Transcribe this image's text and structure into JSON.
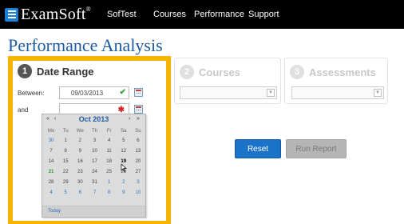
{
  "app": {
    "logo": "ExamSoft",
    "logo_mark": "®"
  },
  "nav": {
    "items": [
      {
        "label": "SofTest"
      },
      {
        "label": "Courses"
      },
      {
        "label": "Performance"
      },
      {
        "label": "Support"
      }
    ]
  },
  "page": {
    "title": "Performance Analysis"
  },
  "steps": [
    {
      "number": "1",
      "label": "Date Range"
    },
    {
      "number": "2",
      "label": "Courses"
    },
    {
      "number": "3",
      "label": "Assessments"
    }
  ],
  "date_range": {
    "between_label": "Between:",
    "and_label": "and",
    "start_value": "09/03/2013",
    "end_value": "",
    "valid_icon": "checkmark-icon",
    "required_icon": "asterisk-icon"
  },
  "calendar": {
    "month_label": "Oct 2013",
    "prev_year": "«",
    "prev_month": "‹",
    "next_month": "›",
    "next_year": "»",
    "weekdays": [
      "Mo",
      "Tu",
      "We",
      "Th",
      "Fr",
      "Sa",
      "Su"
    ],
    "weeks": [
      [
        "30",
        "1",
        "2",
        "3",
        "4",
        "5",
        "6"
      ],
      [
        "7",
        "8",
        "9",
        "10",
        "11",
        "12",
        "13"
      ],
      [
        "14",
        "15",
        "16",
        "17",
        "18",
        "19",
        "20"
      ],
      [
        "21",
        "22",
        "23",
        "24",
        "25",
        "26",
        "27"
      ],
      [
        "28",
        "29",
        "30",
        "31",
        "1",
        "2",
        "3"
      ],
      [
        "4",
        "5",
        "6",
        "7",
        "8",
        "9",
        "10"
      ]
    ],
    "today_label": "Today"
  },
  "actions": {
    "reset_label": "Reset",
    "run_label": "Run Report"
  },
  "colors": {
    "brand_blue": "#1d5a9e",
    "highlight": "#f5b400",
    "reset_button": "#1a73c9",
    "run_button_disabled": "#b5b5b5"
  }
}
